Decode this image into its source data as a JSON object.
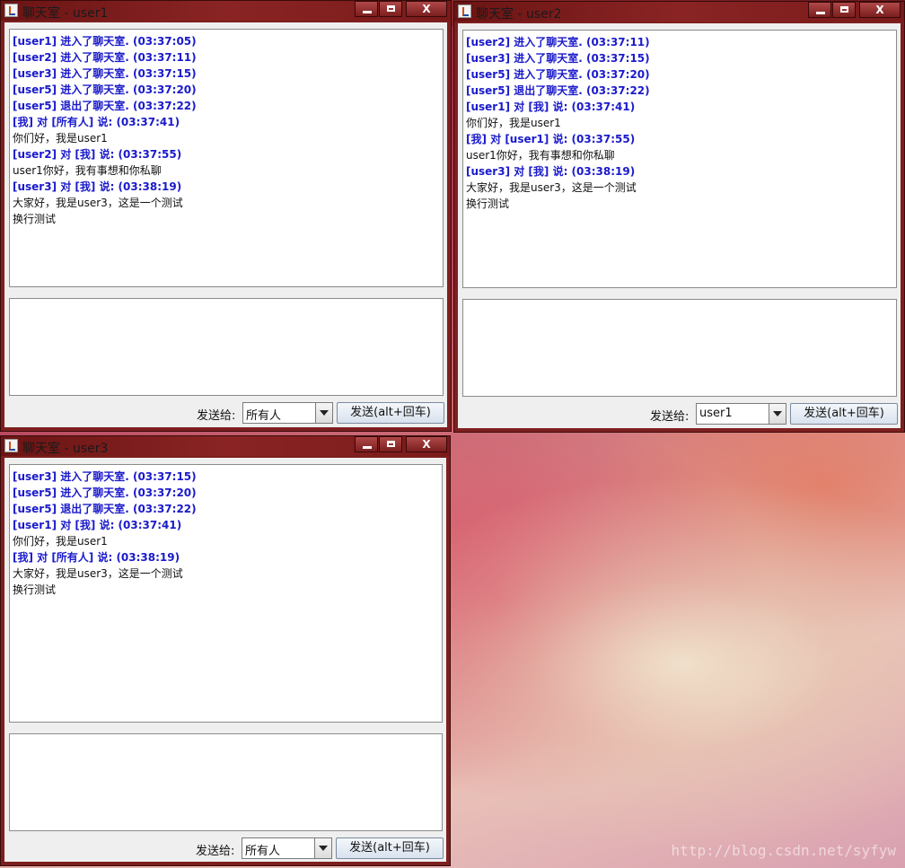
{
  "windows": [
    {
      "title": "聊天室 - user1",
      "log": [
        {
          "type": "sys",
          "text": "[user1] 进入了聊天室. (03:37:05)"
        },
        {
          "type": "sys",
          "text": "[user2] 进入了聊天室. (03:37:11)"
        },
        {
          "type": "sys",
          "text": "[user3] 进入了聊天室. (03:37:15)"
        },
        {
          "type": "sys",
          "text": "[user5] 进入了聊天室. (03:37:20)"
        },
        {
          "type": "sys",
          "text": "[user5] 退出了聊天室. (03:37:22)"
        },
        {
          "type": "sys",
          "text": "[我] 对 [所有人] 说: (03:37:41)"
        },
        {
          "type": "msg",
          "text": "你们好，我是user1"
        },
        {
          "type": "sys",
          "text": "[user2] 对 [我] 说: (03:37:55)"
        },
        {
          "type": "msg",
          "text": "user1你好，我有事想和你私聊"
        },
        {
          "type": "sys",
          "text": "[user3] 对 [我] 说: (03:38:19)"
        },
        {
          "type": "msg",
          "text": "大家好，我是user3，这是一个测试"
        },
        {
          "type": "msg",
          "text": "换行测试"
        }
      ],
      "send_to_label": "发送给:",
      "recipient": "所有人",
      "send_button": "发送(alt+回车)"
    },
    {
      "title": "聊天室 - user2",
      "log": [
        {
          "type": "sys",
          "text": "[user2] 进入了聊天室. (03:37:11)"
        },
        {
          "type": "sys",
          "text": "[user3] 进入了聊天室. (03:37:15)"
        },
        {
          "type": "sys",
          "text": "[user5] 进入了聊天室. (03:37:20)"
        },
        {
          "type": "sys",
          "text": "[user5] 退出了聊天室. (03:37:22)"
        },
        {
          "type": "sys",
          "text": "[user1] 对 [我] 说: (03:37:41)"
        },
        {
          "type": "msg",
          "text": "你们好，我是user1"
        },
        {
          "type": "sys",
          "text": "[我] 对 [user1] 说: (03:37:55)"
        },
        {
          "type": "msg",
          "text": "user1你好，我有事想和你私聊"
        },
        {
          "type": "sys",
          "text": "[user3] 对 [我] 说: (03:38:19)"
        },
        {
          "type": "msg",
          "text": "大家好，我是user3，这是一个测试"
        },
        {
          "type": "msg",
          "text": "换行测试"
        }
      ],
      "send_to_label": "发送给:",
      "recipient": "user1",
      "send_button": "发送(alt+回车)"
    },
    {
      "title": "聊天室 - user3",
      "log": [
        {
          "type": "sys",
          "text": "[user3] 进入了聊天室. (03:37:15)"
        },
        {
          "type": "sys",
          "text": "[user5] 进入了聊天室. (03:37:20)"
        },
        {
          "type": "sys",
          "text": "[user5] 退出了聊天室. (03:37:22)"
        },
        {
          "type": "sys",
          "text": "[user1] 对 [我] 说: (03:37:41)"
        },
        {
          "type": "msg",
          "text": "你们好，我是user1"
        },
        {
          "type": "sys",
          "text": "[我] 对 [所有人] 说: (03:38:19)"
        },
        {
          "type": "msg",
          "text": "大家好，我是user3，这是一个测试"
        },
        {
          "type": "msg",
          "text": "换行测试"
        }
      ],
      "send_to_label": "发送给:",
      "recipient": "所有人",
      "send_button": "发送(alt+回车)"
    }
  ],
  "watermark": "http://blog.csdn.net/syfyw",
  "icons": {
    "app": "java-app-icon",
    "min": "minimize-icon",
    "max": "maximize-icon",
    "close": "close-icon"
  }
}
